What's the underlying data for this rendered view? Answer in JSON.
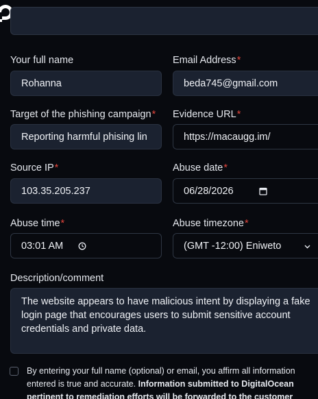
{
  "form": {
    "full_name": {
      "label": "Your full name",
      "value": "Rohanna"
    },
    "email": {
      "label": "Email Address",
      "required_mark": "*",
      "value": "beda745@gmail.com"
    },
    "target": {
      "label": "Target of the phishing campaign",
      "required_mark": "*",
      "value": "Reporting harmful phising lin"
    },
    "evidence_url": {
      "label": "Evidence URL",
      "required_mark": "*",
      "value": "https://macaugg.im/"
    },
    "source_ip": {
      "label": "Source IP",
      "required_mark": "*",
      "value": "103.35.205.237"
    },
    "abuse_date": {
      "label": "Abuse date",
      "required_mark": "*",
      "value": "06/28/2026"
    },
    "abuse_time": {
      "label": "Abuse time",
      "required_mark": "*",
      "value": "03:01 AM"
    },
    "abuse_timezone": {
      "label": "Abuse timezone",
      "required_mark": "*",
      "value": "(GMT -12:00) Eniweto"
    },
    "description": {
      "label": "Description/comment",
      "value": "The website appears to have malicious intent by displaying a fake login page that encourages users to submit sensitive account credentials and private data."
    },
    "consent": {
      "text": "By entering your full name (optional) or email, you affirm all information entered is true and accurate. ",
      "bold_text": "Information submitted to DigitalOcean pertinent to remediation efforts will be forwarded to the customer"
    }
  },
  "colors": {
    "background": "#080a0f",
    "field_filled": "#1b2230",
    "required": "#e0453b"
  }
}
